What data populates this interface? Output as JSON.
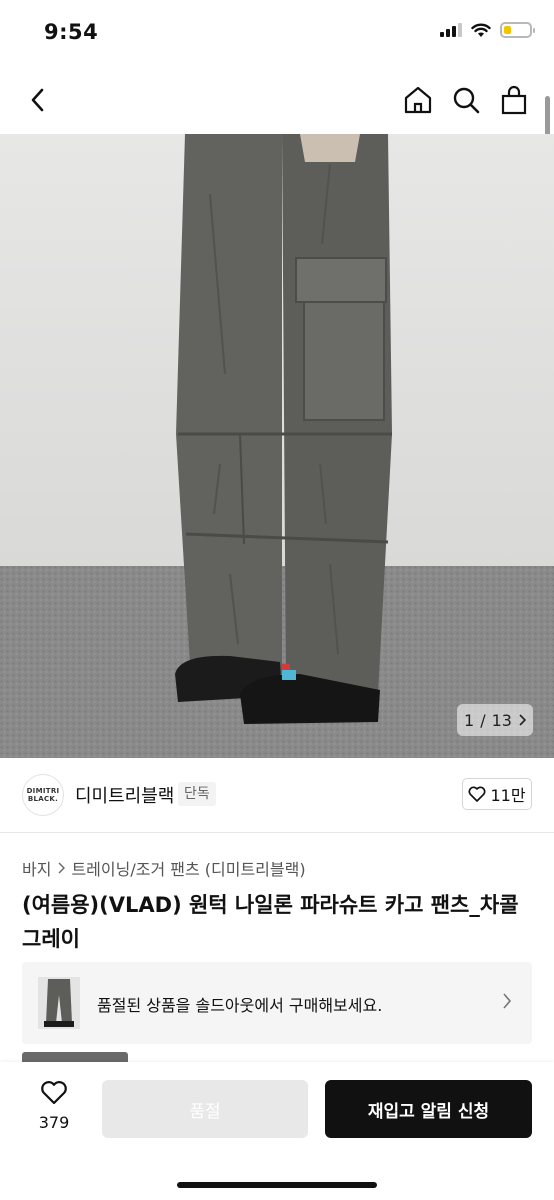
{
  "status_bar": {
    "time": "9:54"
  },
  "gallery": {
    "current": "1",
    "separator": "/",
    "total": "13"
  },
  "brand": {
    "logo_line1": "DIMITRI",
    "logo_line2": "BLACK.",
    "name": "디미트리블랙",
    "badge": "단독",
    "like_count": "11만"
  },
  "breadcrumb": {
    "category": "바지",
    "sub_category": "트레이닝/조거 팬츠 (디미트리블랙)"
  },
  "product": {
    "title": "(여름용)(VLAD) 원턱 나일론 파라슈트 카고 팬츠_차콜 그레이"
  },
  "soldout_banner": {
    "text": "품절된 상품을 솔드아웃에서 구매해보세요."
  },
  "bottom_bar": {
    "wish_count": "379",
    "soldout_label": "품절",
    "restock_label": "재입고 알림 신청"
  }
}
